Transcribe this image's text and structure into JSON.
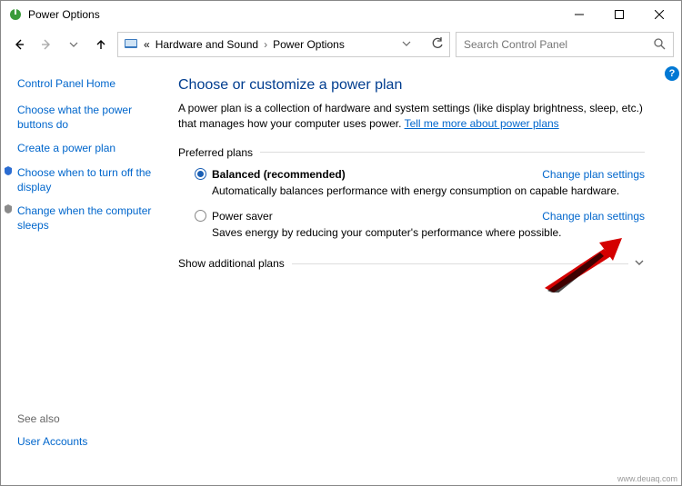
{
  "window": {
    "title": "Power Options"
  },
  "breadcrumb": {
    "prefix": "«",
    "parent": "Hardware and Sound",
    "current": "Power Options"
  },
  "search": {
    "placeholder": "Search Control Panel"
  },
  "sidebar": {
    "home": "Control Panel Home",
    "links": [
      {
        "label": "Choose what the power buttons do",
        "icon": false
      },
      {
        "label": "Create a power plan",
        "icon": false
      },
      {
        "label": "Choose when to turn off the display",
        "icon": true
      },
      {
        "label": "Change when the computer sleeps",
        "icon": true
      }
    ],
    "seealso_label": "See also",
    "seealso_link": "User Accounts"
  },
  "main": {
    "heading": "Choose or customize a power plan",
    "description_pre": "A power plan is a collection of hardware and system settings (like display brightness, sleep, etc.) that manages how your computer uses power. ",
    "description_link": "Tell me more about power plans",
    "preferred_label": "Preferred plans",
    "plans": [
      {
        "name": "Balanced (recommended)",
        "desc": "Automatically balances performance with energy consumption on capable hardware.",
        "selected": true,
        "settings": "Change plan settings"
      },
      {
        "name": "Power saver",
        "desc": "Saves energy by reducing your computer's performance where possible.",
        "selected": false,
        "settings": "Change plan settings"
      }
    ],
    "show_additional": "Show additional plans"
  },
  "watermark": "www.deuaq.com"
}
